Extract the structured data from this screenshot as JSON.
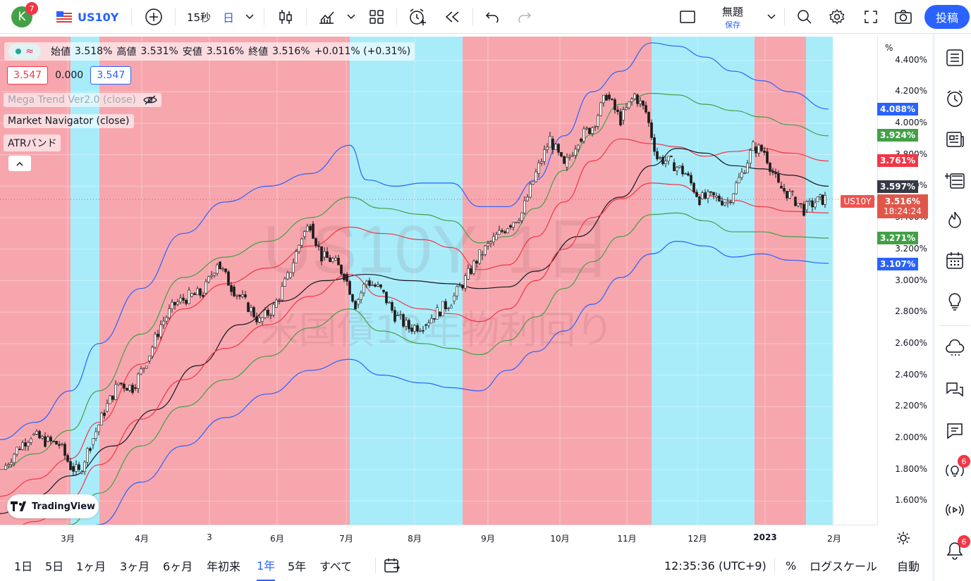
{
  "header": {
    "avatar_letter": "K",
    "avatar_badge": "7",
    "symbol": "US10Y",
    "interval": "15秒",
    "period": "日",
    "layout_name": "無題",
    "layout_status": "保存",
    "post_label": "投稿"
  },
  "legend": {
    "ohlc_open_label": "始値",
    "ohlc_open": "3.518%",
    "ohlc_high_label": "高値",
    "ohlc_high": "3.531%",
    "ohlc_low_label": "安値",
    "ohlc_low": "3.516%",
    "ohlc_close_label": "終値",
    "ohlc_close": "3.516%",
    "change": "+0.011% (+0.31%)",
    "bid": "3.547",
    "spread": "0.000",
    "ask": "3.547",
    "indicators": [
      "Mega Trend Ver2.0 (close)",
      "Market Navigator (close)",
      "ATRバンド"
    ]
  },
  "watermark": {
    "symbol": "US10Y, 1日",
    "description": "米国債10年物利回り"
  },
  "price_axis": {
    "unit": "%",
    "ticks": [
      "4.400%",
      "4.200%",
      "4.000%",
      "3.800%",
      "3.600%",
      "3.400%",
      "3.200%",
      "3.000%",
      "2.800%",
      "2.600%",
      "2.400%",
      "2.200%",
      "2.000%",
      "1.800%",
      "1.600%"
    ],
    "tags": [
      {
        "value": "4.088%",
        "color": "#2962ff"
      },
      {
        "value": "3.924%",
        "color": "#43a047"
      },
      {
        "value": "3.761%",
        "color": "#f23645"
      },
      {
        "value": "3.597%",
        "color": "#363a45"
      },
      {
        "value": "3.434%",
        "color": "#f23645"
      },
      {
        "value": "3.271%",
        "color": "#43a047"
      },
      {
        "value": "3.107%",
        "color": "#2962ff"
      }
    ],
    "last_price": "3.516%",
    "countdown": "18:24:24",
    "symbol_tag": "US10Y"
  },
  "time_axis": {
    "labels": [
      "3月",
      "4月",
      "3",
      "6月",
      "7月",
      "8月",
      "9月",
      "10月",
      "11月",
      "12月",
      "2023",
      "2月"
    ]
  },
  "bottom": {
    "ranges": [
      "1日",
      "5日",
      "1ヶ月",
      "3ヶ月",
      "6ヶ月",
      "年初来",
      "1年",
      "5年",
      "すべて"
    ],
    "active_range": "1年",
    "time": "12:35:36 (UTC+9)",
    "percent": "%",
    "log_scale": "ログスケール",
    "auto": "自動"
  },
  "right_badges": {
    "ideas": "6",
    "alerts": "6"
  },
  "brand": "TradingView",
  "colors": {
    "red_zone": "#f7a6ae",
    "blue_zone": "#a8ecfa",
    "accent": "#2962ff",
    "up": "#26a69a",
    "down": "#ef5350"
  },
  "chart_data": {
    "type": "line",
    "ylim": [
      1.45,
      4.55
    ],
    "x_range": [
      0,
      1244
    ],
    "zones": [
      {
        "type": "red",
        "from": 0,
        "to": 100
      },
      {
        "type": "blue",
        "from": 100,
        "to": 141
      },
      {
        "type": "red",
        "from": 141,
        "to": 496
      },
      {
        "type": "blue",
        "from": 496,
        "to": 656
      },
      {
        "type": "red",
        "from": 656,
        "to": 924
      },
      {
        "type": "blue",
        "from": 924,
        "to": 1070
      },
      {
        "type": "red",
        "from": 1070,
        "to": 1143
      },
      {
        "type": "blue",
        "from": 1143,
        "to": 1181
      }
    ],
    "series": [
      {
        "color": "#2962ff",
        "points": [
          [
            0,
            1.99
          ],
          [
            50,
            2.1
          ],
          [
            100,
            2.3
          ],
          [
            140,
            2.6
          ],
          [
            200,
            2.95
          ],
          [
            260,
            3.3
          ],
          [
            320,
            3.5
          ],
          [
            380,
            3.6
          ],
          [
            440,
            3.68
          ],
          [
            496,
            3.86
          ],
          [
            520,
            3.64
          ],
          [
            560,
            3.6
          ],
          [
            600,
            3.62
          ],
          [
            640,
            3.62
          ],
          [
            680,
            3.47
          ],
          [
            720,
            3.47
          ],
          [
            760,
            3.64
          ],
          [
            800,
            3.92
          ],
          [
            840,
            4.2
          ],
          [
            880,
            4.33
          ],
          [
            924,
            4.51
          ],
          [
            960,
            4.49
          ],
          [
            1000,
            4.42
          ],
          [
            1040,
            4.33
          ],
          [
            1080,
            4.27
          ],
          [
            1120,
            4.2
          ],
          [
            1175,
            4.09
          ]
        ]
      },
      {
        "color": "#43a047",
        "points": [
          [
            0,
            1.8
          ],
          [
            50,
            1.9
          ],
          [
            100,
            2.05
          ],
          [
            140,
            2.3
          ],
          [
            200,
            2.66
          ],
          [
            260,
            3.02
          ],
          [
            320,
            3.15
          ],
          [
            380,
            3.25
          ],
          [
            440,
            3.4
          ],
          [
            496,
            3.53
          ],
          [
            540,
            3.46
          ],
          [
            600,
            3.42
          ],
          [
            640,
            3.38
          ],
          [
            680,
            3.24
          ],
          [
            720,
            3.28
          ],
          [
            760,
            3.46
          ],
          [
            800,
            3.7
          ],
          [
            840,
            3.93
          ],
          [
            880,
            4.12
          ],
          [
            924,
            4.19
          ],
          [
            960,
            4.18
          ],
          [
            1000,
            4.12
          ],
          [
            1040,
            4.08
          ],
          [
            1080,
            4.04
          ],
          [
            1120,
            3.99
          ],
          [
            1175,
            3.92
          ]
        ]
      },
      {
        "color": "#f23645",
        "points": [
          [
            0,
            1.63
          ],
          [
            50,
            1.74
          ],
          [
            100,
            1.87
          ],
          [
            140,
            2.1
          ],
          [
            200,
            2.47
          ],
          [
            260,
            2.82
          ],
          [
            320,
            2.98
          ],
          [
            380,
            3.08
          ],
          [
            440,
            3.22
          ],
          [
            496,
            3.34
          ],
          [
            540,
            3.3
          ],
          [
            600,
            3.26
          ],
          [
            640,
            3.21
          ],
          [
            680,
            3.07
          ],
          [
            720,
            3.1
          ],
          [
            760,
            3.28
          ],
          [
            800,
            3.5
          ],
          [
            840,
            3.76
          ],
          [
            880,
            3.9
          ],
          [
            924,
            3.87
          ],
          [
            960,
            3.85
          ],
          [
            1000,
            3.79
          ],
          [
            1040,
            3.82
          ],
          [
            1080,
            3.84
          ],
          [
            1120,
            3.81
          ],
          [
            1175,
            3.76
          ]
        ]
      },
      {
        "color": "#131722",
        "points": [
          [
            0,
            1.52
          ],
          [
            50,
            1.63
          ],
          [
            100,
            1.76
          ],
          [
            160,
            1.95
          ],
          [
            220,
            2.18
          ],
          [
            280,
            2.46
          ],
          [
            340,
            2.72
          ],
          [
            400,
            2.87
          ],
          [
            460,
            3.0
          ],
          [
            520,
            3.04
          ],
          [
            580,
            3.0
          ],
          [
            640,
            2.98
          ],
          [
            680,
            2.95
          ],
          [
            720,
            2.96
          ],
          [
            760,
            3.06
          ],
          [
            820,
            3.28
          ],
          [
            880,
            3.53
          ],
          [
            924,
            3.73
          ],
          [
            960,
            3.84
          ],
          [
            1000,
            3.81
          ],
          [
            1040,
            3.73
          ],
          [
            1080,
            3.71
          ],
          [
            1120,
            3.67
          ],
          [
            1175,
            3.6
          ]
        ]
      },
      {
        "color": "#f23645",
        "points": [
          [
            0,
            1.38
          ],
          [
            50,
            1.47
          ],
          [
            100,
            1.62
          ],
          [
            140,
            1.83
          ],
          [
            200,
            2.12
          ],
          [
            260,
            2.37
          ],
          [
            320,
            2.57
          ],
          [
            380,
            2.72
          ],
          [
            440,
            2.9
          ],
          [
            496,
            3.04
          ],
          [
            540,
            2.9
          ],
          [
            600,
            2.82
          ],
          [
            640,
            2.79
          ],
          [
            680,
            2.74
          ],
          [
            720,
            2.82
          ],
          [
            760,
            3.0
          ],
          [
            800,
            3.2
          ],
          [
            840,
            3.4
          ],
          [
            880,
            3.52
          ],
          [
            924,
            3.62
          ],
          [
            960,
            3.61
          ],
          [
            1000,
            3.54
          ],
          [
            1040,
            3.51
          ],
          [
            1080,
            3.47
          ],
          [
            1120,
            3.44
          ],
          [
            1175,
            3.43
          ]
        ]
      },
      {
        "color": "#43a047",
        "points": [
          [
            0,
            1.23
          ],
          [
            50,
            1.3
          ],
          [
            100,
            1.45
          ],
          [
            140,
            1.65
          ],
          [
            200,
            1.95
          ],
          [
            260,
            2.2
          ],
          [
            320,
            2.37
          ],
          [
            380,
            2.52
          ],
          [
            440,
            2.7
          ],
          [
            496,
            2.82
          ],
          [
            540,
            2.68
          ],
          [
            600,
            2.6
          ],
          [
            640,
            2.57
          ],
          [
            680,
            2.53
          ],
          [
            720,
            2.62
          ],
          [
            760,
            2.77
          ],
          [
            800,
            2.95
          ],
          [
            840,
            3.12
          ],
          [
            880,
            3.28
          ],
          [
            924,
            3.42
          ],
          [
            960,
            3.43
          ],
          [
            1000,
            3.38
          ],
          [
            1040,
            3.31
          ],
          [
            1080,
            3.31
          ],
          [
            1120,
            3.28
          ],
          [
            1175,
            3.27
          ]
        ]
      },
      {
        "color": "#2962ff",
        "points": [
          [
            0,
            1.05
          ],
          [
            50,
            1.12
          ],
          [
            100,
            1.25
          ],
          [
            140,
            1.45
          ],
          [
            200,
            1.72
          ],
          [
            260,
            1.95
          ],
          [
            320,
            2.13
          ],
          [
            380,
            2.28
          ],
          [
            440,
            2.43
          ],
          [
            496,
            2.5
          ],
          [
            540,
            2.4
          ],
          [
            600,
            2.35
          ],
          [
            640,
            2.32
          ],
          [
            680,
            2.3
          ],
          [
            720,
            2.43
          ],
          [
            760,
            2.55
          ],
          [
            800,
            2.68
          ],
          [
            840,
            2.85
          ],
          [
            880,
            3.02
          ],
          [
            924,
            3.17
          ],
          [
            960,
            3.25
          ],
          [
            1000,
            3.22
          ],
          [
            1040,
            3.15
          ],
          [
            1080,
            3.17
          ],
          [
            1120,
            3.13
          ],
          [
            1175,
            3.11
          ]
        ]
      }
    ],
    "candles_close": [
      [
        4,
        1.8
      ],
      [
        24,
        1.93
      ],
      [
        44,
        2.02
      ],
      [
        64,
        1.98
      ],
      [
        84,
        1.96
      ],
      [
        100,
        1.82
      ],
      [
        112,
        1.78
      ],
      [
        128,
        1.96
      ],
      [
        148,
        2.17
      ],
      [
        168,
        2.35
      ],
      [
        188,
        2.32
      ],
      [
        208,
        2.49
      ],
      [
        228,
        2.72
      ],
      [
        248,
        2.85
      ],
      [
        268,
        2.9
      ],
      [
        288,
        2.92
      ],
      [
        308,
        3.12
      ],
      [
        328,
        2.96
      ],
      [
        348,
        2.86
      ],
      [
        368,
        2.74
      ],
      [
        388,
        2.83
      ],
      [
        408,
        3.02
      ],
      [
        428,
        3.28
      ],
      [
        440,
        3.36
      ],
      [
        456,
        3.15
      ],
      [
        472,
        3.13
      ],
      [
        488,
        3.04
      ],
      [
        504,
        2.85
      ],
      [
        520,
        3.0
      ],
      [
        540,
        2.94
      ],
      [
        560,
        2.78
      ],
      [
        580,
        2.7
      ],
      [
        600,
        2.72
      ],
      [
        620,
        2.8
      ],
      [
        640,
        2.87
      ],
      [
        660,
        3.01
      ],
      [
        680,
        3.16
      ],
      [
        700,
        3.26
      ],
      [
        720,
        3.35
      ],
      [
        740,
        3.43
      ],
      [
        760,
        3.68
      ],
      [
        780,
        3.9
      ],
      [
        800,
        3.72
      ],
      [
        820,
        3.9
      ],
      [
        840,
        3.98
      ],
      [
        860,
        4.18
      ],
      [
        880,
        4.02
      ],
      [
        900,
        4.18
      ],
      [
        916,
        4.07
      ],
      [
        932,
        3.78
      ],
      [
        952,
        3.75
      ],
      [
        972,
        3.68
      ],
      [
        992,
        3.52
      ],
      [
        1012,
        3.53
      ],
      [
        1032,
        3.5
      ],
      [
        1052,
        3.68
      ],
      [
        1068,
        3.85
      ],
      [
        1084,
        3.82
      ],
      [
        1104,
        3.6
      ],
      [
        1124,
        3.53
      ],
      [
        1140,
        3.45
      ],
      [
        1156,
        3.5
      ],
      [
        1170,
        3.52
      ]
    ]
  }
}
